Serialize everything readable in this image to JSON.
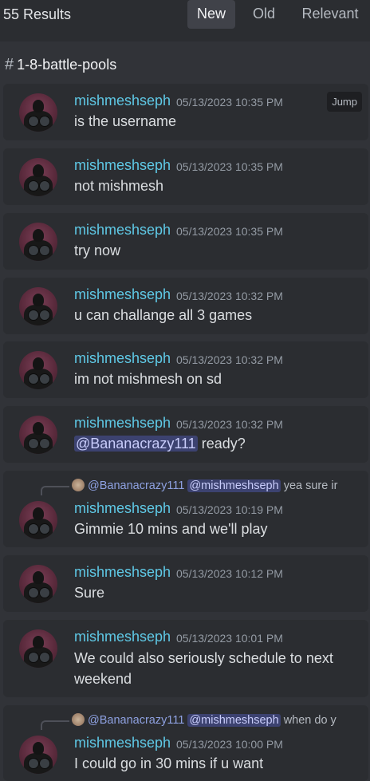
{
  "header": {
    "results": "55 Results",
    "tabs": [
      {
        "label": "New",
        "active": true
      },
      {
        "label": "Old",
        "active": false
      },
      {
        "label": "Relevant",
        "active": false
      }
    ]
  },
  "channel": {
    "hash": "#",
    "name": "1-8-battle-pools"
  },
  "jump_label": "Jump",
  "messages": [
    {
      "author": "mishmeshseph",
      "time": "05/13/2023 10:35 PM",
      "text": "is the username"
    },
    {
      "author": "mishmeshseph",
      "time": "05/13/2023 10:35 PM",
      "text": "not mishmesh"
    },
    {
      "author": "mishmeshseph",
      "time": "05/13/2023 10:35 PM",
      "text": "try now"
    },
    {
      "author": "mishmeshseph",
      "time": "05/13/2023 10:32 PM",
      "text": "u can challange all 3 games"
    },
    {
      "author": "mishmeshseph",
      "time": "05/13/2023 10:32 PM",
      "text": "im not mishmesh on sd"
    },
    {
      "author": "mishmeshseph",
      "time": "05/13/2023 10:32 PM",
      "mention": "@Bananacrazy111",
      "text": " ready?"
    },
    {
      "author": "mishmeshseph",
      "time": "05/13/2023 10:19 PM",
      "text": "Gimmie 10 mins and we'll play",
      "reply": {
        "author": "@Bananacrazy111",
        "mention": "@mishmeshseph",
        "snippet": "yea sure ir"
      }
    },
    {
      "author": "mishmeshseph",
      "time": "05/13/2023 10:12 PM",
      "text": "Sure"
    },
    {
      "author": "mishmeshseph",
      "time": "05/13/2023 10:01 PM",
      "text_line1": "We could also seriously schedule to next",
      "text_line2": "weekend"
    },
    {
      "author": "mishmeshseph",
      "time": "05/13/2023 10:00 PM",
      "text": "I could go in 30 mins if u want",
      "reply": {
        "author": "@Bananacrazy111",
        "mention": "@mishmeshseph",
        "snippet": "when do y"
      }
    }
  ]
}
